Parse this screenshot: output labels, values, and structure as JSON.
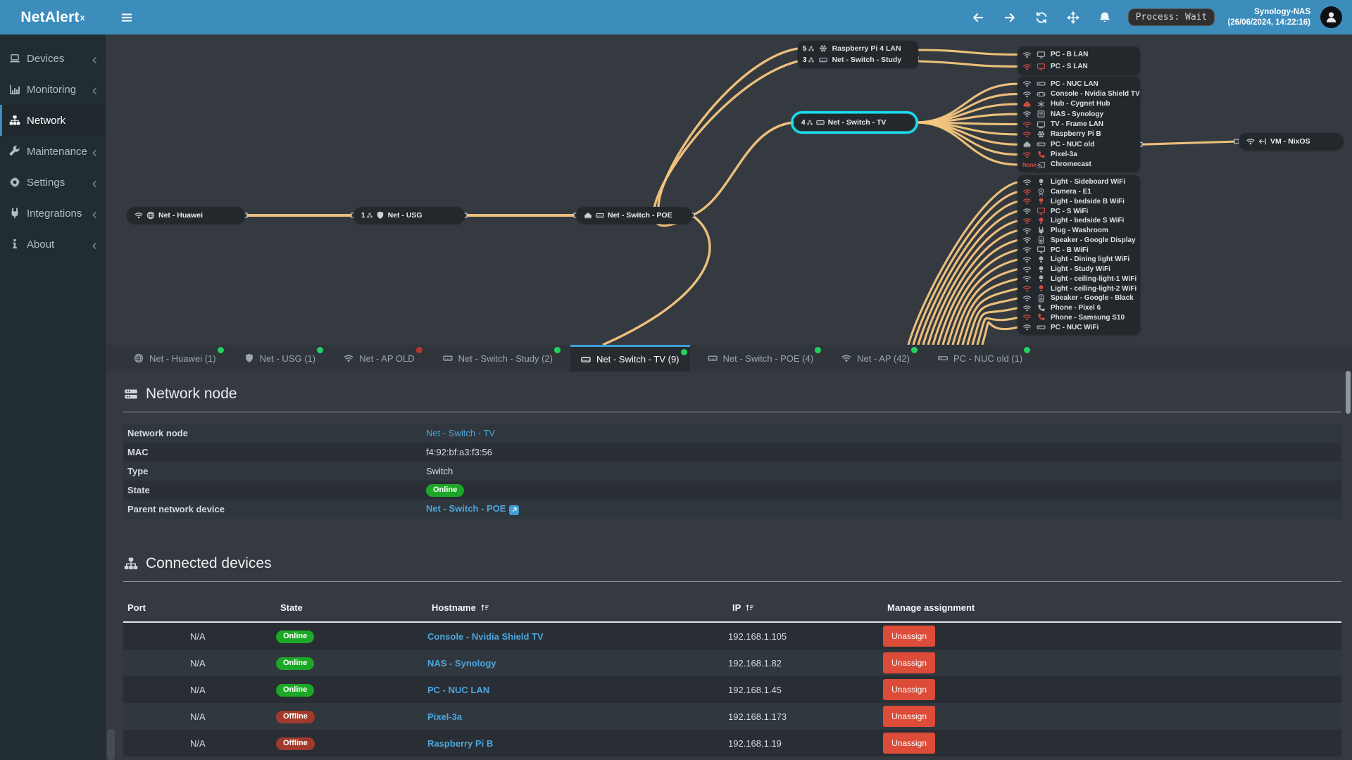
{
  "topbar": {
    "brand": "NetAlert",
    "brand_sup": "x",
    "process_badge": "Process: Wait",
    "host": "Synology-NAS",
    "timestamp": "(26/06/2024, 14:22:16)"
  },
  "sidebar": {
    "items": [
      {
        "label": "Devices",
        "icon": "laptop",
        "chevron": true,
        "active": false
      },
      {
        "label": "Monitoring",
        "icon": "chart",
        "chevron": true,
        "active": false
      },
      {
        "label": "Network",
        "icon": "sitemap",
        "chevron": false,
        "active": true
      },
      {
        "label": "Maintenance",
        "icon": "wrench",
        "chevron": true,
        "active": false
      },
      {
        "label": "Settings",
        "icon": "gear",
        "chevron": true,
        "active": false
      },
      {
        "label": "Integrations",
        "icon": "plug",
        "chevron": true,
        "active": false
      },
      {
        "label": "About",
        "icon": "info",
        "chevron": true,
        "active": false
      }
    ]
  },
  "diagram": {
    "nodes": {
      "huawei": {
        "label": "Net - Huawei",
        "icons": [
          "wifi",
          "globe"
        ]
      },
      "usg": {
        "badge": "1",
        "label": "Net - USG",
        "icons": [
          "shield"
        ]
      },
      "poe": {
        "label": "Net - Switch - POE",
        "icons": [
          "eth",
          "switch"
        ]
      },
      "study_rows": [
        {
          "badge": "5",
          "icon": "raspberry",
          "label": "Raspberry Pi 4 LAN"
        },
        {
          "badge": "3",
          "icon": "switch",
          "label": "Net - Switch - Study"
        }
      ],
      "tv": {
        "badge": "4",
        "icon": "switch",
        "label": "Net - Switch - TV",
        "highlighted": true
      },
      "vm": {
        "label": "VM - NixOS",
        "icons": [
          "wifi",
          "vm"
        ]
      }
    },
    "group1": [
      {
        "net": "wifi",
        "net_alert": false,
        "icon": "monitor",
        "icon_alert": false,
        "label": "PC - B LAN"
      },
      {
        "net": "wifi",
        "net_alert": true,
        "icon": "monitor",
        "icon_alert": true,
        "label": "PC - S LAN"
      }
    ],
    "group2": [
      {
        "net": "wifi",
        "net_alert": false,
        "icon": "minipc",
        "icon_alert": false,
        "label": "PC - NUC LAN"
      },
      {
        "net": "wifi",
        "net_alert": false,
        "icon": "console",
        "icon_alert": false,
        "label": "Console - Nvidia Shield TV"
      },
      {
        "net": "eth",
        "net_alert": true,
        "icon": "hub",
        "icon_alert": false,
        "label": "Hub - Cygnet Hub"
      },
      {
        "net": "wifi",
        "net_alert": false,
        "icon": "nas",
        "icon_alert": false,
        "label": "NAS - Synology"
      },
      {
        "net": "wifi",
        "net_alert": true,
        "icon": "tvframe",
        "icon_alert": false,
        "label": "TV - Frame LAN"
      },
      {
        "net": "wifi",
        "net_alert": true,
        "icon": "raspberry",
        "icon_alert": false,
        "label": "Raspberry Pi B"
      },
      {
        "net": "eth",
        "net_alert": false,
        "icon": "minipc",
        "icon_alert": false,
        "label": "PC - NUC old"
      },
      {
        "net": "wifi",
        "net_alert": true,
        "icon": "phone",
        "icon_alert": true,
        "label": "Pixel-3a"
      },
      {
        "net": "none",
        "net_alert": true,
        "icon": "cast",
        "icon_alert": false,
        "label": "Chromecast",
        "net_text": "None"
      }
    ],
    "group3": [
      {
        "net": "wifi",
        "net_alert": false,
        "icon": "bulb",
        "icon_alert": false,
        "label": "Light - Sideboard WiFi"
      },
      {
        "net": "wifi",
        "net_alert": true,
        "icon": "camera",
        "icon_alert": false,
        "label": "Camera - E1"
      },
      {
        "net": "wifi",
        "net_alert": true,
        "icon": "bulb",
        "icon_alert": true,
        "label": "Light - bedside B WiFi"
      },
      {
        "net": "wifi",
        "net_alert": false,
        "icon": "monitor",
        "icon_alert": true,
        "label": "PC - S WiFi"
      },
      {
        "net": "wifi",
        "net_alert": true,
        "icon": "bulb",
        "icon_alert": true,
        "label": "Light - bedside S WiFi"
      },
      {
        "net": "wifi",
        "net_alert": false,
        "icon": "plugw",
        "icon_alert": false,
        "label": "Plug - Washroom"
      },
      {
        "net": "wifi",
        "net_alert": false,
        "icon": "speaker",
        "icon_alert": false,
        "label": "Speaker - Google Display"
      },
      {
        "net": "wifi",
        "net_alert": false,
        "icon": "monitor",
        "icon_alert": false,
        "label": "PC - B WiFi"
      },
      {
        "net": "wifi",
        "net_alert": false,
        "icon": "bulb",
        "icon_alert": false,
        "label": "Light - Dining light WiFi"
      },
      {
        "net": "wifi",
        "net_alert": false,
        "icon": "bulb",
        "icon_alert": false,
        "label": "Light - Study WiFi"
      },
      {
        "net": "wifi",
        "net_alert": false,
        "icon": "bulb",
        "icon_alert": false,
        "label": "Light - ceiling-light-1 WiFi"
      },
      {
        "net": "wifi",
        "net_alert": true,
        "icon": "bulb",
        "icon_alert": true,
        "label": "Light - ceiling-light-2 WiFi"
      },
      {
        "net": "wifi",
        "net_alert": false,
        "icon": "speaker",
        "icon_alert": false,
        "label": "Speaker - Google - Black"
      },
      {
        "net": "wifi",
        "net_alert": false,
        "icon": "phone",
        "icon_alert": false,
        "label": "Phone - Pixel 6"
      },
      {
        "net": "wifi",
        "net_alert": true,
        "icon": "phone",
        "icon_alert": true,
        "label": "Phone - Samsung S10"
      },
      {
        "net": "wifi",
        "net_alert": false,
        "icon": "minipc",
        "icon_alert": false,
        "label": "PC - NUC WiFi"
      }
    ]
  },
  "tabs": [
    {
      "label": "Net - Huawei (1)",
      "icon": "globe",
      "dot": "green",
      "active": false
    },
    {
      "label": "Net - USG (1)",
      "icon": "shield",
      "dot": "green",
      "active": false
    },
    {
      "label": "Net - AP OLD",
      "icon": "wifi",
      "dot": "red",
      "active": false
    },
    {
      "label": "Net - Switch - Study (2)",
      "icon": "switch",
      "dot": "green",
      "active": false
    },
    {
      "label": "Net - Switch - TV (9)",
      "icon": "switch",
      "dot": "green",
      "active": true
    },
    {
      "label": "Net - Switch - POE (4)",
      "icon": "switch",
      "dot": "green",
      "active": false
    },
    {
      "label": "Net - AP (42)",
      "icon": "wifi",
      "dot": "green",
      "active": false
    },
    {
      "label": "PC - NUC old (1)",
      "icon": "minipc",
      "dot": "green",
      "active": false
    }
  ],
  "node_section": {
    "title": "Network node",
    "rows": [
      {
        "label": "Network node",
        "value": "Net - Switch - TV",
        "type": "link"
      },
      {
        "label": "MAC",
        "value": "f4:92:bf:a3:f3:56",
        "type": "text"
      },
      {
        "label": "Type",
        "value": "Switch",
        "type": "text"
      },
      {
        "label": "State",
        "value": "Online",
        "type": "badge"
      },
      {
        "label": "Parent network device",
        "value": "Net - Switch - POE",
        "type": "link-ext"
      }
    ]
  },
  "devices_section": {
    "title": "Connected devices",
    "columns": [
      {
        "label": "Port",
        "sortable": false
      },
      {
        "label": "State",
        "sortable": false
      },
      {
        "label": "Hostname",
        "sortable": true
      },
      {
        "label": "IP",
        "sortable": true
      },
      {
        "label": "Manage assignment",
        "sortable": false
      }
    ],
    "unassign_label": "Unassign",
    "rows": [
      {
        "port": "N/A",
        "state": "Online",
        "hostname": "Console - Nvidia Shield TV",
        "ip": "192.168.1.105"
      },
      {
        "port": "N/A",
        "state": "Online",
        "hostname": "NAS - Synology",
        "ip": "192.168.1.82"
      },
      {
        "port": "N/A",
        "state": "Online",
        "hostname": "PC - NUC LAN",
        "ip": "192.168.1.45"
      },
      {
        "port": "N/A",
        "state": "Offline",
        "hostname": "Pixel-3a",
        "ip": "192.168.1.173"
      },
      {
        "port": "N/A",
        "state": "Offline",
        "hostname": "Raspberry Pi B",
        "ip": "192.168.1.19"
      }
    ]
  },
  "colors": {
    "accent": "#3c8dbc",
    "line": "#f7c67f",
    "highlight": "#19dff0",
    "online": "#1ca826",
    "offline": "#a23a2c",
    "danger": "#dd4b39",
    "link": "#4ba6dd",
    "dot_green": "#23d160",
    "dot_red": "#b5372c",
    "icon_alert": "#cc4b3f"
  }
}
